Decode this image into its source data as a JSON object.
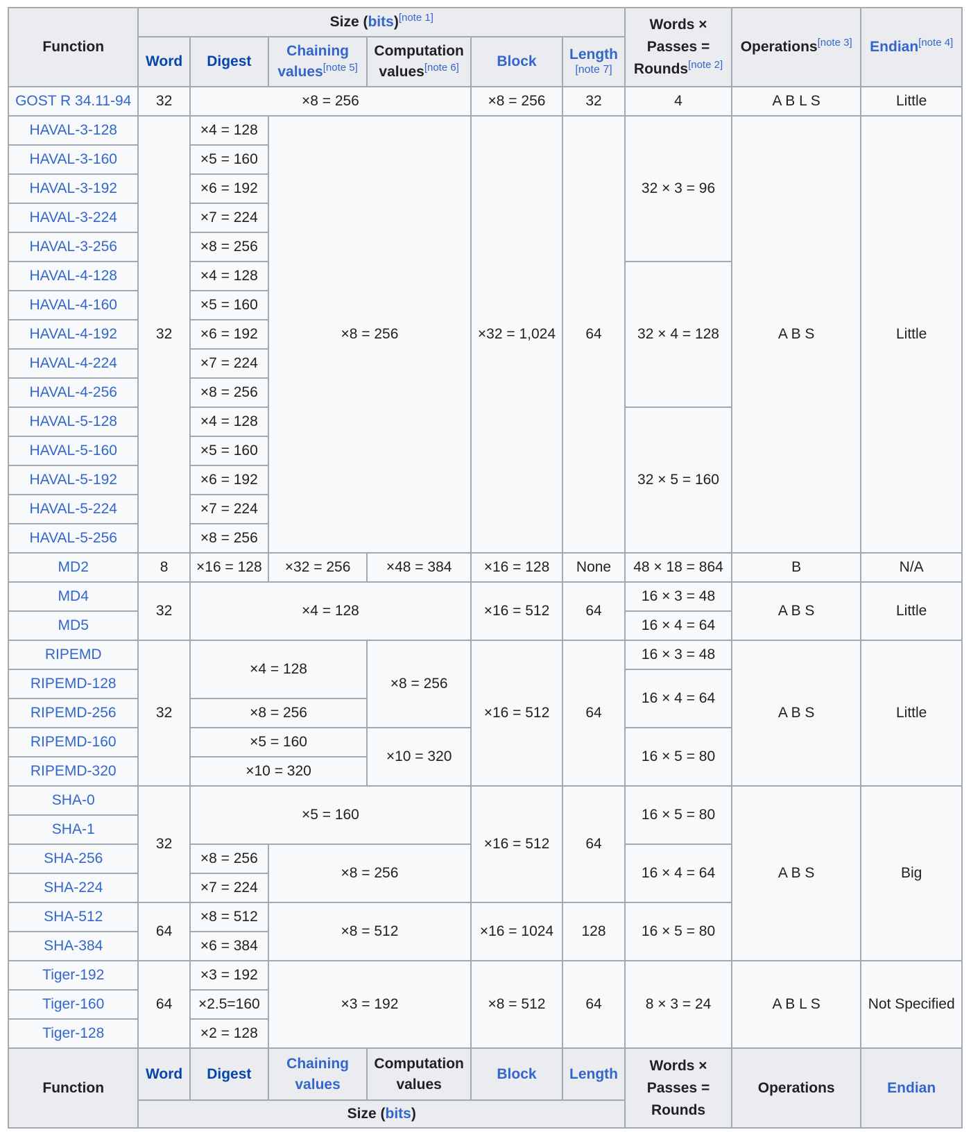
{
  "header": {
    "function": "Function",
    "size_label": "Size (",
    "size_bits_link": "bits",
    "size_close": ")",
    "size_note": "[note 1]",
    "word": "Word",
    "digest": "Digest",
    "chaining_a": "Chaining",
    "chaining_b": "values",
    "chaining_note": "[note 5]",
    "computation_a": "Computation",
    "computation_b": "values",
    "computation_note": "[note 6]",
    "block": "Block",
    "length": "Length",
    "length_note": "[note 7]",
    "wpr_a": "Words ×",
    "wpr_b": "Passes =",
    "wpr_c": "Rounds",
    "wpr_note": "[note 2]",
    "operations": "Operations",
    "operations_note": "[note 3]",
    "endian": "Endian",
    "endian_note": "[note 4]"
  },
  "rows": {
    "gost": {
      "fn": "GOST R 34.11-94",
      "word": "32",
      "digest": "×8 = 256",
      "block": "×8 = 256",
      "length": "32",
      "wpr": "4",
      "ops": "A B L S",
      "endian": "Little"
    },
    "haval": {
      "word": "32",
      "chain": "×8 = 256",
      "block": "×32 = 1,024",
      "length": "64",
      "ops": "A B S",
      "endian": "Little",
      "wpr3": "32 × 3 = 96",
      "wpr4": "32 × 4 = 128",
      "wpr5": "32 × 5 = 160",
      "fns": [
        "HAVAL-3-128",
        "HAVAL-3-160",
        "HAVAL-3-192",
        "HAVAL-3-224",
        "HAVAL-3-256",
        "HAVAL-4-128",
        "HAVAL-4-160",
        "HAVAL-4-192",
        "HAVAL-4-224",
        "HAVAL-4-256",
        "HAVAL-5-128",
        "HAVAL-5-160",
        "HAVAL-5-192",
        "HAVAL-5-224",
        "HAVAL-5-256"
      ],
      "digests": [
        "×4 = 128",
        "×5 = 160",
        "×6 = 192",
        "×7 = 224",
        "×8 = 256",
        "×4 = 128",
        "×5 = 160",
        "×6 = 192",
        "×7 = 224",
        "×8 = 256",
        "×4 = 128",
        "×5 = 160",
        "×6 = 192",
        "×7 = 224",
        "×8 = 256"
      ]
    },
    "md2": {
      "fn": "MD2",
      "word": "8",
      "digest": "×16 = 128",
      "chain": "×32 = 256",
      "comp": "×48 = 384",
      "block": "×16 = 128",
      "length": "None",
      "wpr": "48 × 18 = 864",
      "ops": "B",
      "endian": "N/A"
    },
    "md45": {
      "fn1": "MD4",
      "fn2": "MD5",
      "word": "32",
      "digest": "×4 = 128",
      "block": "×16 = 512",
      "length": "64",
      "wpr1": "16 × 3 = 48",
      "wpr2": "16 × 4 = 64",
      "ops": "A B S",
      "endian": "Little"
    },
    "ripemd": {
      "fns": [
        "RIPEMD",
        "RIPEMD-128",
        "RIPEMD-256",
        "RIPEMD-160",
        "RIPEMD-320"
      ],
      "word": "32",
      "d1": "×4 = 128",
      "d2": "×8 = 256",
      "d3": "×5 = 160",
      "d4": "×10 = 320",
      "c1": "×8 = 256",
      "c2": "×10 = 320",
      "block": "×16 = 512",
      "length": "64",
      "wpr1": "16 × 3 = 48",
      "wpr2": "16 × 4 = 64",
      "wpr3": "16 × 5 = 80",
      "ops": "A B S",
      "endian": "Little"
    },
    "sha": {
      "fns": [
        "SHA-0",
        "SHA-1",
        "SHA-256",
        "SHA-224",
        "SHA-512",
        "SHA-384"
      ],
      "word32": "32",
      "d01": "×5 = 160",
      "d256": "×8 = 256",
      "d224": "×7 = 224",
      "c2": "×8 = 256",
      "block32": "×16 = 512",
      "length32": "64",
      "wpr01": "16 × 5 = 80",
      "wpr2": "16 × 4 = 64",
      "word64": "64",
      "d512": "×8 = 512",
      "d384": "×6 = 384",
      "c5": "×8 = 512",
      "block64": "×16 = 1024",
      "length64": "128",
      "wpr5": "16 × 5 = 80",
      "ops": "A B S",
      "endian": "Big"
    },
    "tiger": {
      "fns": [
        "Tiger-192",
        "Tiger-160",
        "Tiger-128"
      ],
      "word": "64",
      "d1": "×3 = 192",
      "d2": "×2.5=160",
      "d3": "×2 = 128",
      "chain": "×3 = 192",
      "block": "×8 = 512",
      "length": "64",
      "wpr": "8 × 3 = 24",
      "ops": "A B L S",
      "endian": "Not Specified"
    }
  },
  "footer": {
    "function": "Function",
    "word": "Word",
    "digest": "Digest",
    "chaining_a": "Chaining",
    "chaining_b": "values",
    "computation_a": "Computation",
    "computation_b": "values",
    "block": "Block",
    "length": "Length",
    "wpr_a": "Words ×",
    "wpr_b": "Passes =",
    "wpr_c": "Rounds",
    "operations": "Operations",
    "endian": "Endian",
    "size_label": "Size (",
    "size_bits_link": "bits",
    "size_close": ")"
  },
  "colors": {
    "link": "#3366cc",
    "header_bg": "#eaecf0",
    "body_bg": "#f8f9fa",
    "border": "#a2a9b1",
    "text": "#202122"
  }
}
